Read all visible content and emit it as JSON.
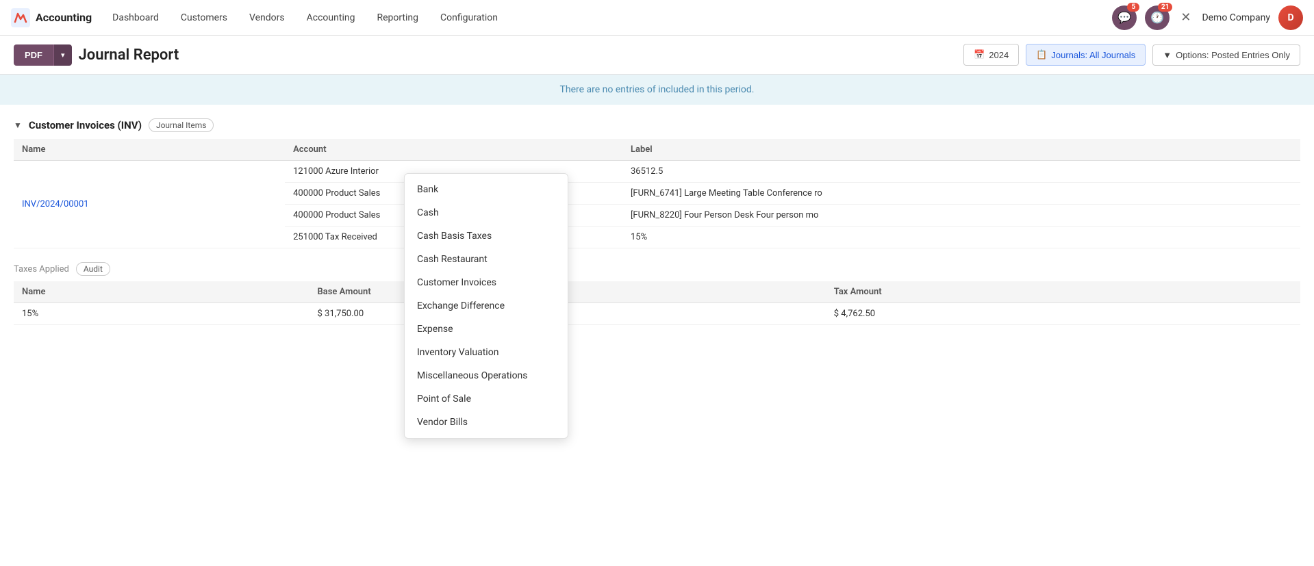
{
  "brand": {
    "name": "Accounting",
    "icon": "✕"
  },
  "nav": {
    "items": [
      {
        "id": "dashboard",
        "label": "Dashboard"
      },
      {
        "id": "customers",
        "label": "Customers"
      },
      {
        "id": "vendors",
        "label": "Vendors"
      },
      {
        "id": "accounting",
        "label": "Accounting"
      },
      {
        "id": "reporting",
        "label": "Reporting"
      },
      {
        "id": "configuration",
        "label": "Configuration"
      }
    ]
  },
  "nav_right": {
    "messages_count": "5",
    "activity_count": "21",
    "company_name": "Demo Company"
  },
  "toolbar": {
    "pdf_label": "PDF",
    "title": "Journal Report",
    "date_filter": "2024",
    "journal_filter": "Journals: All Journals",
    "options_filter": "Options: Posted Entries Only"
  },
  "info_banner": {
    "text": "There are no entries of included in this period."
  },
  "section": {
    "title": "Customer Invoices (INV)",
    "badge": "Journal Items",
    "columns": [
      "Name",
      "Account",
      "Label"
    ],
    "rows": [
      {
        "name": "INV/2024/00001",
        "entries": [
          {
            "account": "121000 Azure Interior",
            "label": "36512.5"
          },
          {
            "account": "400000 Product Sales",
            "label": "[FURN_6741] Large Meeting Table Conference ro"
          },
          {
            "account": "400000 Product Sales",
            "label": "[FURN_8220] Four Person Desk Four person mo"
          },
          {
            "account": "251000 Tax Received",
            "label": "15%"
          }
        ]
      }
    ]
  },
  "tax_section": {
    "label": "Taxes Applied",
    "badge": "Audit",
    "columns": [
      "Name",
      "Base Amount",
      "Tax Amount"
    ],
    "rows": [
      {
        "name": "15%",
        "base_amount": "$ 31,750.00",
        "tax_amount": "$ 4,762.50"
      }
    ]
  },
  "dropdown": {
    "items": [
      "Bank",
      "Cash",
      "Cash Basis Taxes",
      "Cash Restaurant",
      "Customer Invoices",
      "Exchange Difference",
      "Expense",
      "Inventory Valuation",
      "Miscellaneous Operations",
      "Point of Sale",
      "Vendor Bills"
    ]
  }
}
